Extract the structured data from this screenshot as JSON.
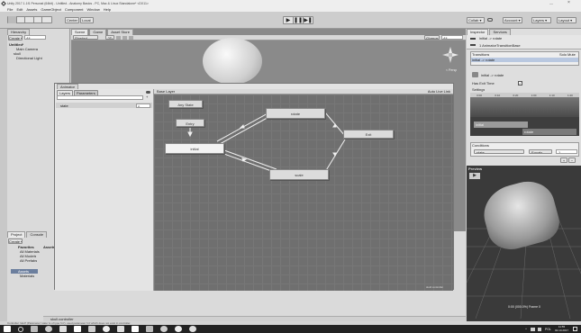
{
  "window": {
    "title": "Unity 2017.1.1f1 Personal (64bit) - Untitled - Anatomy Basics - PC, Mac & Linux Standalone* <DX11>",
    "minimize": "—",
    "close": "×"
  },
  "menu": [
    "File",
    "Edit",
    "Assets",
    "GameObject",
    "Component",
    "Window",
    "Help"
  ],
  "toolbar": {
    "center": "Center",
    "local": "Local",
    "collab": "Collab ▾",
    "account": "Account ▾",
    "layers": "Layers ▾",
    "layout": "Layout ▾"
  },
  "hierarchy": {
    "tab": "Hierarchy",
    "create": "Create ▾",
    "search": "All",
    "scene": "Untitled*",
    "items": [
      "Main Camera",
      "skull",
      "Directional Light"
    ]
  },
  "scene_tabs": [
    "Scene",
    "Game",
    "Asset Store"
  ],
  "scene_toolbar": {
    "shading": "Shaded",
    "mode": "2D",
    "gizmos": "Gizmos ▾",
    "search": "All"
  },
  "gizmo_label": "< Persp",
  "inspector": {
    "tabs": [
      "Inspector",
      "Services"
    ],
    "title": "initial -> rotate",
    "subtitle": "1 AnimatorTransitionBase",
    "transitions_header": "Transitions",
    "solo": "Solo",
    "mute": "Mute",
    "transition_item": "initial -> rotate",
    "transition_name": "initial -> rotate",
    "has_exit_time": "Has Exit Time",
    "settings": "Settings",
    "timeline_ticks": [
      "0:00",
      "0:10",
      "0:20",
      "1:00",
      "1:10",
      "1:20"
    ],
    "timeline_clips": [
      "initial",
      "rotate"
    ],
    "conditions": "Conditions",
    "condition_param": "state",
    "condition_op": "Equals",
    "condition_value": "1",
    "add_button": "+",
    "remove_button": "−"
  },
  "preview": {
    "title": "Preview",
    "footer": "0:00 (000.0%) Frame 0"
  },
  "animator": {
    "tab": "Animator",
    "left_tabs": [
      "Layers",
      "Parameters"
    ],
    "param_name": "state",
    "param_value": "0",
    "layer": "Base Layer",
    "auto_live": "Auto Live Link",
    "footer": "skull.controller",
    "states": {
      "any": "Any State",
      "entry": "Entry",
      "initial": "initial",
      "rotate": "rotate",
      "scale": "scale",
      "exit": "Exit"
    }
  },
  "project": {
    "tabs": [
      "Project",
      "Console"
    ],
    "create": "Create ▾",
    "favorites": "Favorites",
    "fav_items": [
      "All Materials",
      "All Models",
      "All Prefabs"
    ],
    "assets": "Assets",
    "asset_items": [
      "Materials"
    ],
    "assets_header": "Assets",
    "footer": "skull.controller"
  },
  "status_bar": "Controller 'skull' (Parameter 'state' is of type 'Int'), used parameter 'int' which does not exist in controller.",
  "taskbar": {
    "lang": "POL",
    "time": "11:55",
    "date": "02.10.2017"
  }
}
